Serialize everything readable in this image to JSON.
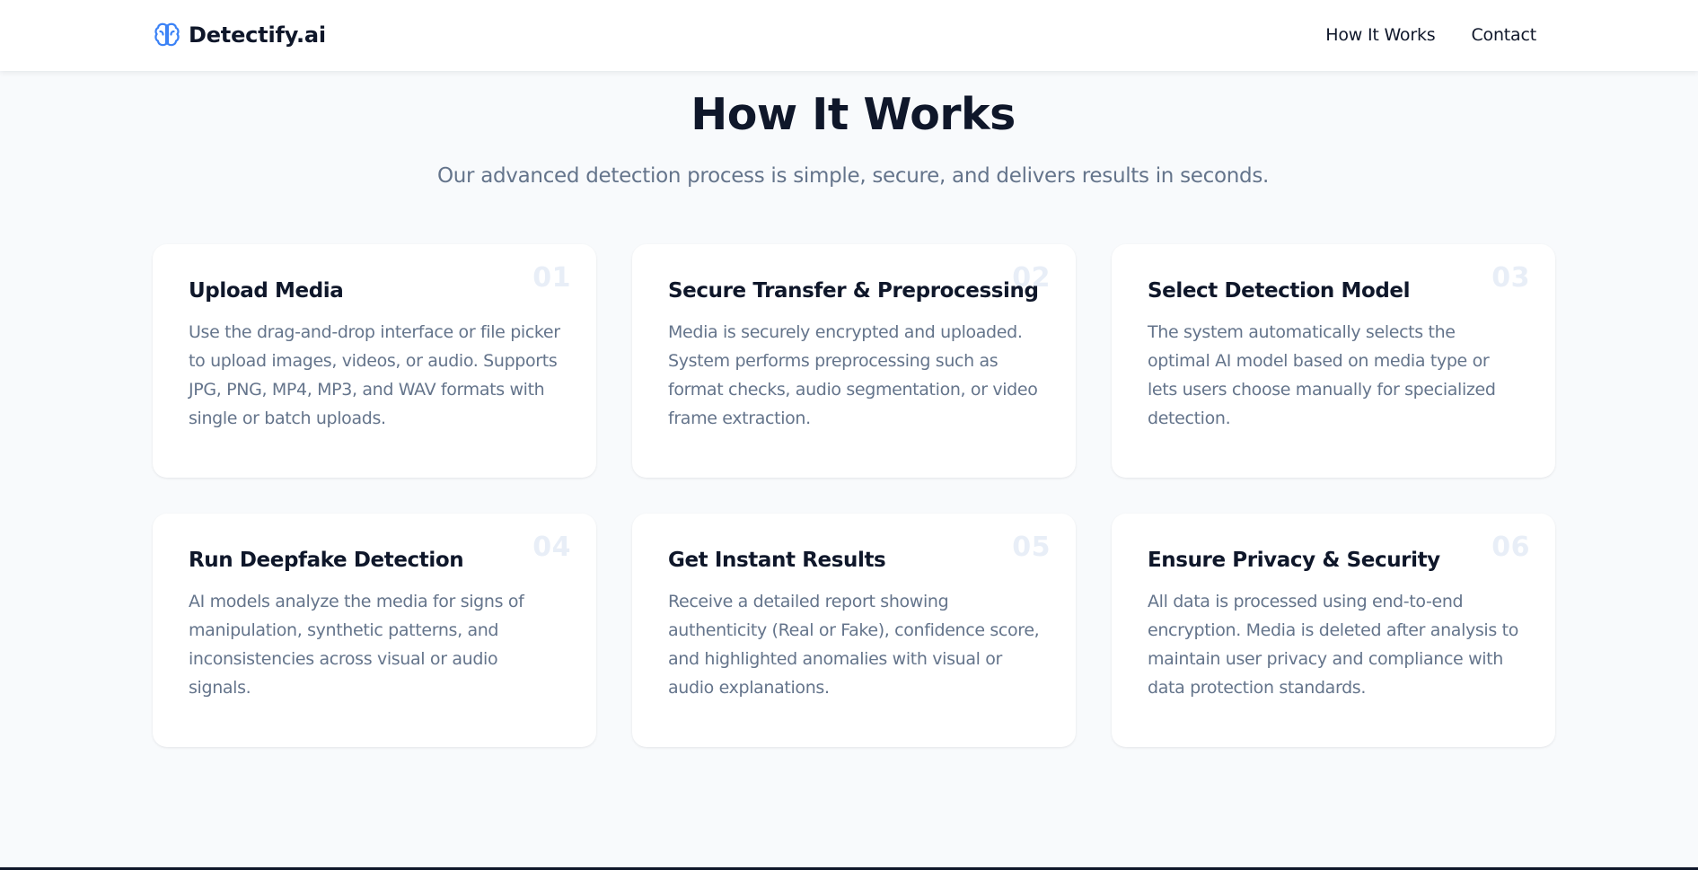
{
  "nav": {
    "brand": "Detectify.ai",
    "brand_icon": "brain-icon",
    "links": [
      {
        "label": "How It Works"
      },
      {
        "label": "Contact"
      }
    ]
  },
  "section": {
    "title": "How It Works",
    "subtitle": "Our advanced detection process is simple, secure, and delivers results in seconds."
  },
  "steps": [
    {
      "number": "01",
      "title": "Upload Media",
      "description": "Use the drag-and-drop interface or file picker to upload images, videos, or audio. Supports JPG, PNG, MP4, MP3, and WAV formats with single or batch uploads."
    },
    {
      "number": "02",
      "title": "Secure Transfer & Preprocessing",
      "description": "Media is securely encrypted and uploaded. System performs preprocessing such as format checks, audio segmentation, or video frame extraction."
    },
    {
      "number": "03",
      "title": "Select Detection Model",
      "description": "The system automatically selects the optimal AI model based on media type or lets users choose manually for specialized detection."
    },
    {
      "number": "04",
      "title": "Run Deepfake Detection",
      "description": "AI models analyze the media for signs of manipulation, synthetic patterns, and inconsistencies across visual or audio signals."
    },
    {
      "number": "05",
      "title": "Get Instant Results",
      "description": "Receive a detailed report showing authenticity (Real or Fake), confidence score, and highlighted anomalies with visual or audio explanations."
    },
    {
      "number": "06",
      "title": "Ensure Privacy & Security",
      "description": "All data is processed using end-to-end encryption. Media is deleted after analysis to maintain user privacy and compliance with data protection standards."
    }
  ],
  "colors": {
    "accent": "#3b82f6",
    "heading": "#0f172a",
    "body_text": "#64748b",
    "background": "#f8fafc",
    "card": "#ffffff",
    "step_number": "#e8eef7"
  }
}
